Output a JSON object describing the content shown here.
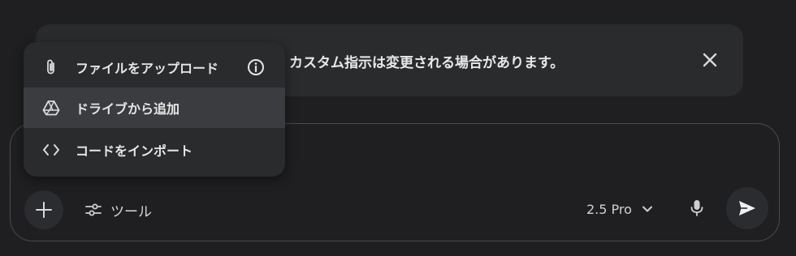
{
  "banner": {
    "message": "カスタム指示は変更される場合があります。",
    "close_icon": "close-icon"
  },
  "menu": {
    "items": [
      {
        "label": "ファイルをアップロード",
        "icon": "paperclip-icon",
        "info_icon": "info-icon"
      },
      {
        "label": "ドライブから追加",
        "icon": "drive-icon",
        "highlighted": true
      },
      {
        "label": "コードをインポート",
        "icon": "code-icon"
      }
    ]
  },
  "composer": {
    "add_icon": "plus-icon",
    "tools_label": "ツール",
    "tools_icon": "sliders-icon",
    "model_label": "2.5 Pro",
    "model_chevron_icon": "chevron-down-icon",
    "mic_icon": "microphone-icon",
    "send_icon": "send-icon"
  },
  "colors": {
    "background": "#1f1f21",
    "surface": "#2a2b2d",
    "menu_highlight": "#3b3c3f",
    "text": "#e3e3e3"
  }
}
